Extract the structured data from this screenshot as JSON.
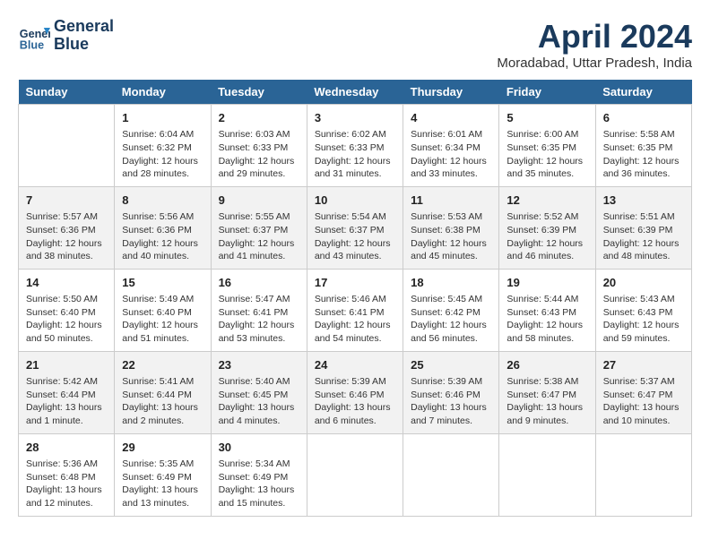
{
  "header": {
    "logo_line1": "General",
    "logo_line2": "Blue",
    "month_year": "April 2024",
    "location": "Moradabad, Uttar Pradesh, India"
  },
  "days_of_week": [
    "Sunday",
    "Monday",
    "Tuesday",
    "Wednesday",
    "Thursday",
    "Friday",
    "Saturday"
  ],
  "weeks": [
    [
      {
        "day": "",
        "info": ""
      },
      {
        "day": "1",
        "info": "Sunrise: 6:04 AM\nSunset: 6:32 PM\nDaylight: 12 hours\nand 28 minutes."
      },
      {
        "day": "2",
        "info": "Sunrise: 6:03 AM\nSunset: 6:33 PM\nDaylight: 12 hours\nand 29 minutes."
      },
      {
        "day": "3",
        "info": "Sunrise: 6:02 AM\nSunset: 6:33 PM\nDaylight: 12 hours\nand 31 minutes."
      },
      {
        "day": "4",
        "info": "Sunrise: 6:01 AM\nSunset: 6:34 PM\nDaylight: 12 hours\nand 33 minutes."
      },
      {
        "day": "5",
        "info": "Sunrise: 6:00 AM\nSunset: 6:35 PM\nDaylight: 12 hours\nand 35 minutes."
      },
      {
        "day": "6",
        "info": "Sunrise: 5:58 AM\nSunset: 6:35 PM\nDaylight: 12 hours\nand 36 minutes."
      }
    ],
    [
      {
        "day": "7",
        "info": "Sunrise: 5:57 AM\nSunset: 6:36 PM\nDaylight: 12 hours\nand 38 minutes."
      },
      {
        "day": "8",
        "info": "Sunrise: 5:56 AM\nSunset: 6:36 PM\nDaylight: 12 hours\nand 40 minutes."
      },
      {
        "day": "9",
        "info": "Sunrise: 5:55 AM\nSunset: 6:37 PM\nDaylight: 12 hours\nand 41 minutes."
      },
      {
        "day": "10",
        "info": "Sunrise: 5:54 AM\nSunset: 6:37 PM\nDaylight: 12 hours\nand 43 minutes."
      },
      {
        "day": "11",
        "info": "Sunrise: 5:53 AM\nSunset: 6:38 PM\nDaylight: 12 hours\nand 45 minutes."
      },
      {
        "day": "12",
        "info": "Sunrise: 5:52 AM\nSunset: 6:39 PM\nDaylight: 12 hours\nand 46 minutes."
      },
      {
        "day": "13",
        "info": "Sunrise: 5:51 AM\nSunset: 6:39 PM\nDaylight: 12 hours\nand 48 minutes."
      }
    ],
    [
      {
        "day": "14",
        "info": "Sunrise: 5:50 AM\nSunset: 6:40 PM\nDaylight: 12 hours\nand 50 minutes."
      },
      {
        "day": "15",
        "info": "Sunrise: 5:49 AM\nSunset: 6:40 PM\nDaylight: 12 hours\nand 51 minutes."
      },
      {
        "day": "16",
        "info": "Sunrise: 5:47 AM\nSunset: 6:41 PM\nDaylight: 12 hours\nand 53 minutes."
      },
      {
        "day": "17",
        "info": "Sunrise: 5:46 AM\nSunset: 6:41 PM\nDaylight: 12 hours\nand 54 minutes."
      },
      {
        "day": "18",
        "info": "Sunrise: 5:45 AM\nSunset: 6:42 PM\nDaylight: 12 hours\nand 56 minutes."
      },
      {
        "day": "19",
        "info": "Sunrise: 5:44 AM\nSunset: 6:43 PM\nDaylight: 12 hours\nand 58 minutes."
      },
      {
        "day": "20",
        "info": "Sunrise: 5:43 AM\nSunset: 6:43 PM\nDaylight: 12 hours\nand 59 minutes."
      }
    ],
    [
      {
        "day": "21",
        "info": "Sunrise: 5:42 AM\nSunset: 6:44 PM\nDaylight: 13 hours\nand 1 minute."
      },
      {
        "day": "22",
        "info": "Sunrise: 5:41 AM\nSunset: 6:44 PM\nDaylight: 13 hours\nand 2 minutes."
      },
      {
        "day": "23",
        "info": "Sunrise: 5:40 AM\nSunset: 6:45 PM\nDaylight: 13 hours\nand 4 minutes."
      },
      {
        "day": "24",
        "info": "Sunrise: 5:39 AM\nSunset: 6:46 PM\nDaylight: 13 hours\nand 6 minutes."
      },
      {
        "day": "25",
        "info": "Sunrise: 5:39 AM\nSunset: 6:46 PM\nDaylight: 13 hours\nand 7 minutes."
      },
      {
        "day": "26",
        "info": "Sunrise: 5:38 AM\nSunset: 6:47 PM\nDaylight: 13 hours\nand 9 minutes."
      },
      {
        "day": "27",
        "info": "Sunrise: 5:37 AM\nSunset: 6:47 PM\nDaylight: 13 hours\nand 10 minutes."
      }
    ],
    [
      {
        "day": "28",
        "info": "Sunrise: 5:36 AM\nSunset: 6:48 PM\nDaylight: 13 hours\nand 12 minutes."
      },
      {
        "day": "29",
        "info": "Sunrise: 5:35 AM\nSunset: 6:49 PM\nDaylight: 13 hours\nand 13 minutes."
      },
      {
        "day": "30",
        "info": "Sunrise: 5:34 AM\nSunset: 6:49 PM\nDaylight: 13 hours\nand 15 minutes."
      },
      {
        "day": "",
        "info": ""
      },
      {
        "day": "",
        "info": ""
      },
      {
        "day": "",
        "info": ""
      },
      {
        "day": "",
        "info": ""
      }
    ]
  ]
}
